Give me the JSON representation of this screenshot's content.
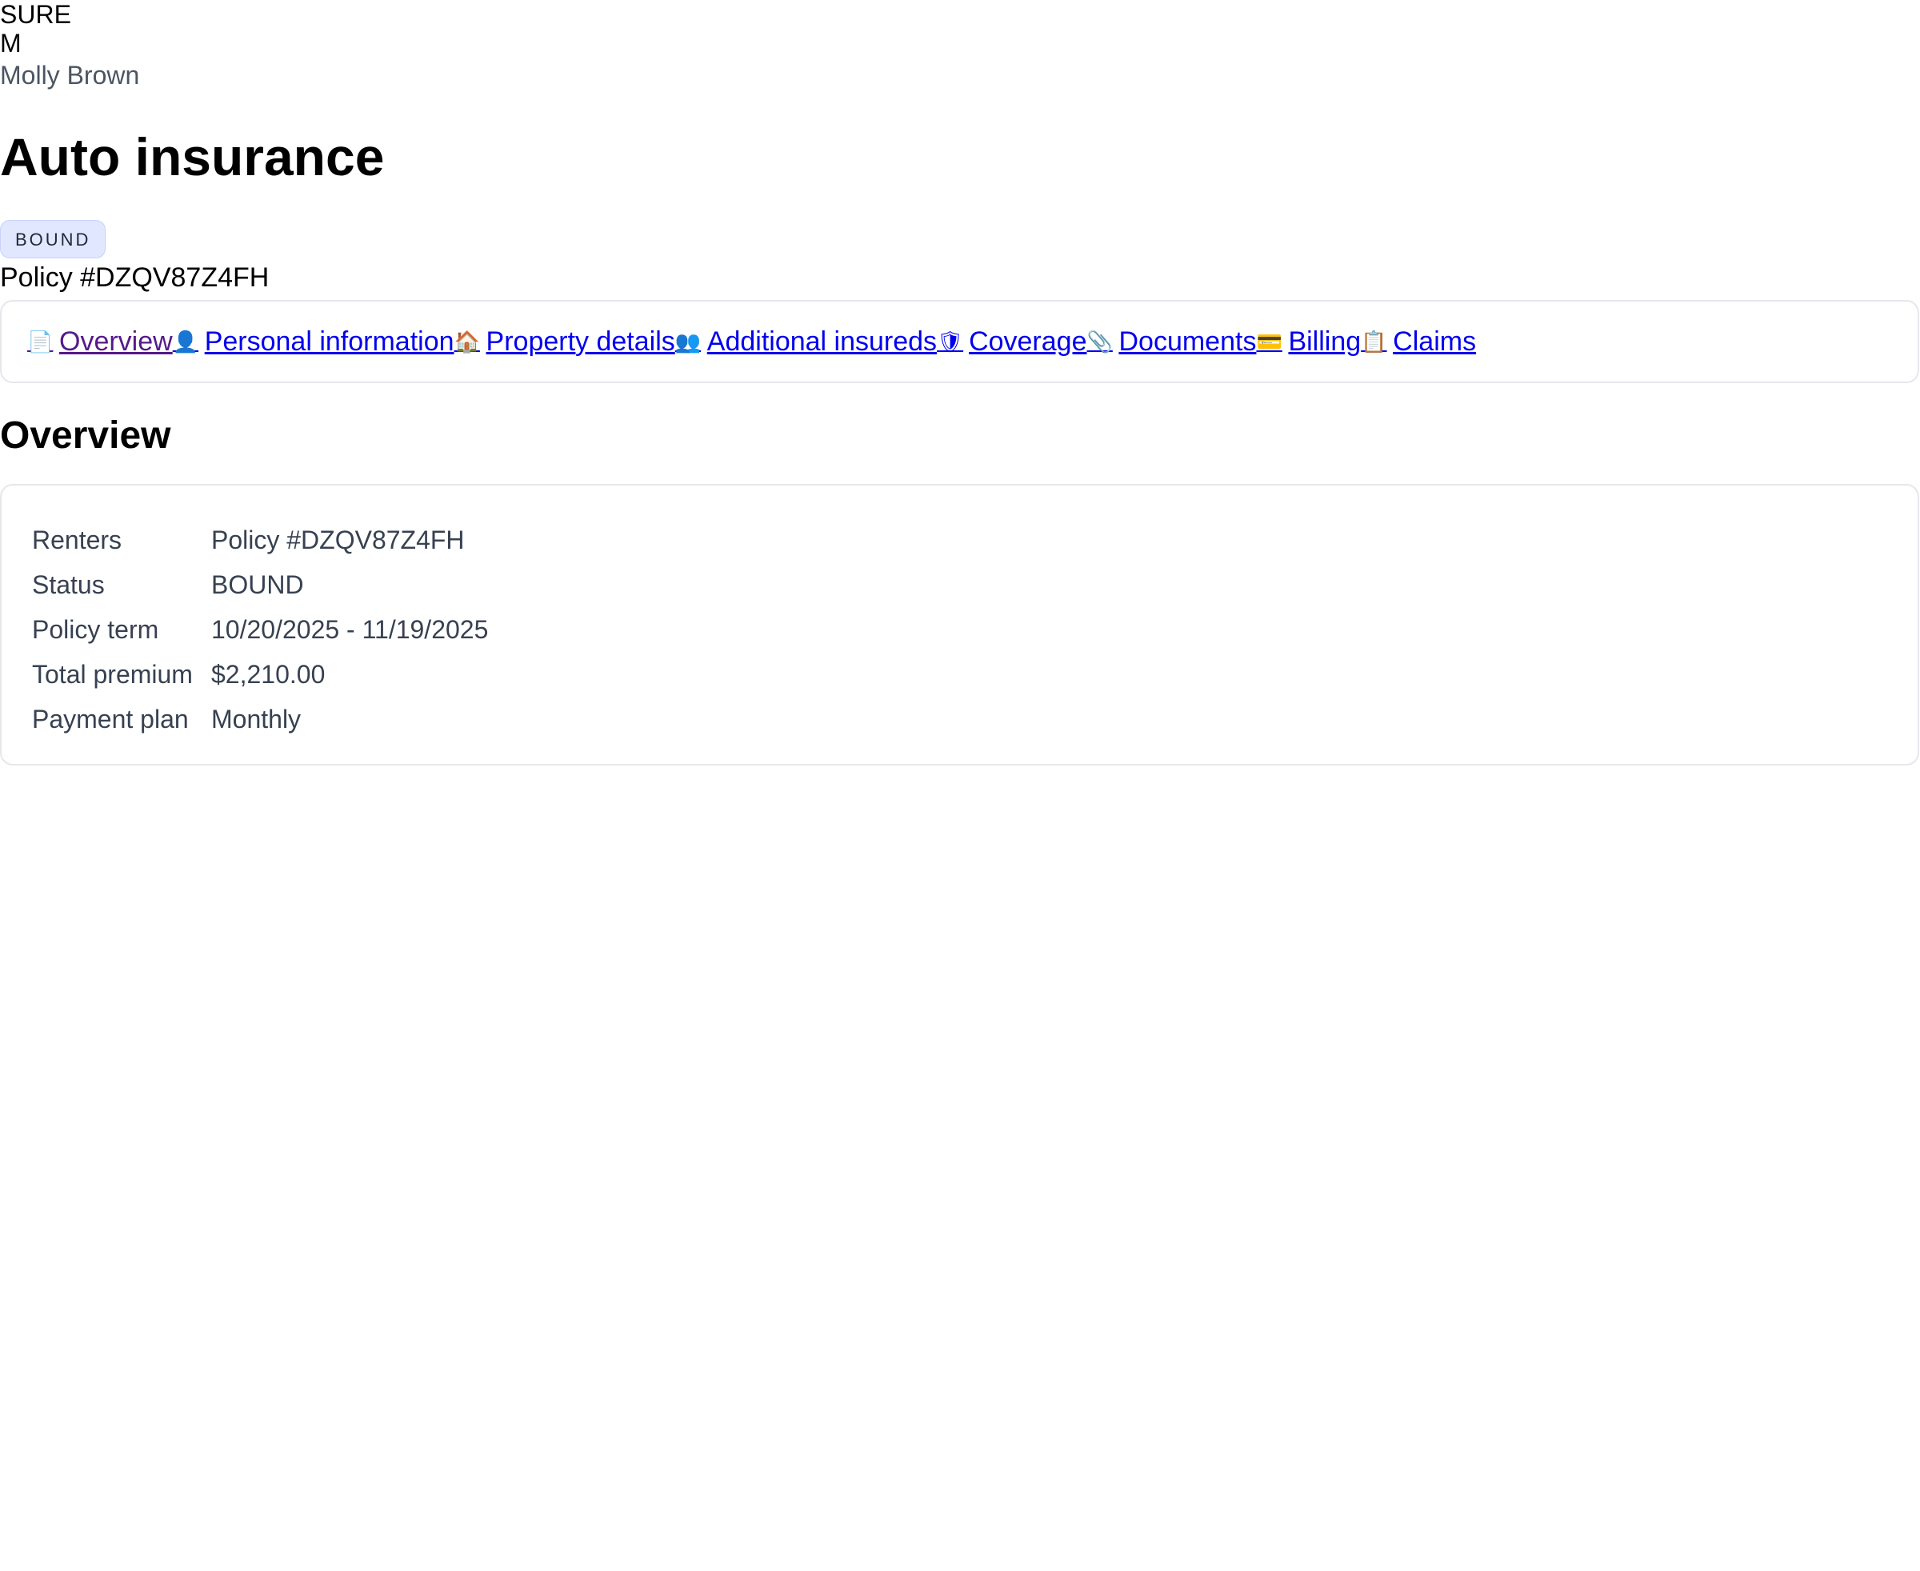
{
  "header": {
    "brand": "SURE",
    "avatar_initial": "M",
    "user_name": "Molly Brown"
  },
  "policy": {
    "title": "Auto insurance",
    "status_badge": "BOUND",
    "policy_number": "Policy #DZQV87Z4FH"
  },
  "tabs": [
    {
      "icon": "document-icon",
      "glyph": "📄",
      "label": "Overview"
    },
    {
      "icon": "person-icon",
      "glyph": "👤",
      "label": "Personal information"
    },
    {
      "icon": "house-icon",
      "glyph": "🏠",
      "label": "Property details"
    },
    {
      "icon": "people-icon",
      "glyph": "👥",
      "label": "Additional insureds"
    },
    {
      "icon": "shield-icon",
      "glyph": "🛡",
      "label": "Coverage"
    },
    {
      "icon": "paperclip-icon",
      "glyph": "📎",
      "label": "Documents"
    },
    {
      "icon": "credit-card-icon",
      "glyph": "💳",
      "label": "Billing"
    },
    {
      "icon": "clipboard-icon",
      "glyph": "📋",
      "label": "Claims"
    }
  ],
  "overview": {
    "section_title": "Overview",
    "rows": [
      {
        "label": "Renters",
        "value": "Policy #DZQV87Z4FH"
      },
      {
        "label": "Status",
        "value": "BOUND"
      },
      {
        "label": "Policy term",
        "value": "10/20/2025 - 11/19/2025"
      },
      {
        "label": "Total premium",
        "value": "$2,210.00"
      },
      {
        "label": "Payment plan",
        "value": "Monthly"
      }
    ]
  }
}
